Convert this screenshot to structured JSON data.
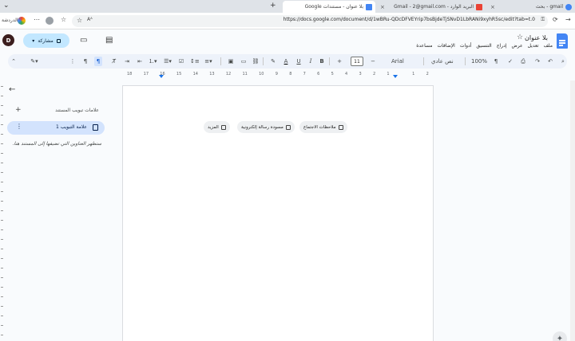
{
  "browser": {
    "tabs": [
      {
        "title": "gmail - بحث",
        "favicon_color": "#4285f4"
      },
      {
        "title": "البريد الوارد - Gmail - 2@gmail.com",
        "favicon_color": "#ea4335"
      },
      {
        "title": "بلا عنوان - مستندات Google",
        "favicon_color": "#4285f4"
      }
    ],
    "close_glyph": "×",
    "new_tab_glyph": "+",
    "url": "https://docs.google.com/document/d/1wBRu-QDcDFVEYrip7bsBjdeTjSNvD1LbRANi9xyhR5sc/edit?tab=t.0",
    "reader_label": "Aᴬ",
    "sidebar_label": "الدردشة",
    "more_glyph": "⋯"
  },
  "docs": {
    "title": "بلا عنوان",
    "star": "☆",
    "menu": [
      "ملف",
      "تعديل",
      "عرض",
      "إدراج",
      "التنسيق",
      "أدوات",
      "الإضافات",
      "مساعدة"
    ],
    "avatar_letter": "D",
    "share_label": "مشاركة",
    "share_caret": "▾"
  },
  "toolbar": {
    "zoom": "100%",
    "style": "نص عادي",
    "font": "Arial",
    "font_size": "11",
    "minus": "−",
    "plus": "+",
    "bold": "B",
    "italic": "I",
    "underline": "U",
    "text_color": "A"
  },
  "ruler": {
    "numbers": [
      "18",
      "17",
      "16",
      "15",
      "14",
      "13",
      "12",
      "11",
      "10",
      "9",
      "8",
      "7",
      "6",
      "5",
      "4",
      "3",
      "2",
      "1",
      "",
      "1",
      "2"
    ]
  },
  "outline": {
    "back_glyph": "←",
    "heading": "علامات تبويب المستند",
    "add_glyph": "+",
    "tab_label": "علامة التبويب 1",
    "tab_menu_glyph": "⋮",
    "hint": "ستظهر العناوين التي تضيفها إلى المستند هنا."
  },
  "page": {
    "chips": [
      {
        "label": "ملاحظات الاجتماع"
      },
      {
        "label": "مسودة رسالة إلكترونية"
      },
      {
        "label": "المزيد"
      }
    ]
  }
}
